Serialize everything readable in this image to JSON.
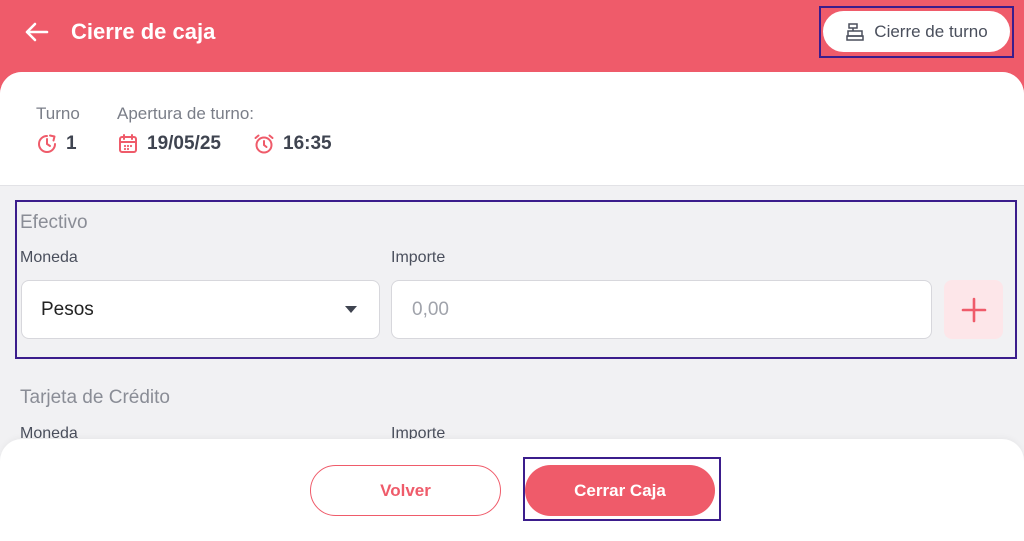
{
  "header": {
    "title": "Cierre de caja",
    "back_icon": "arrow-left-icon",
    "shift_close_label": "Cierre de turno",
    "shift_close_icon": "cash-register-icon"
  },
  "shift_info": {
    "turno_label": "Turno",
    "turno_value": "1",
    "apertura_label": "Apertura de turno:",
    "date": "19/05/25",
    "time": "16:35"
  },
  "efectivo": {
    "title": "Efectivo",
    "currency_label": "Moneda",
    "currency_value": "Pesos",
    "amount_label": "Importe",
    "amount_placeholder": "0,00"
  },
  "tarjeta": {
    "title": "Tarjeta de Crédito",
    "currency_label": "Moneda",
    "amount_label": "Importe"
  },
  "footer": {
    "back_label": "Volver",
    "close_label": "Cerrar Caja"
  },
  "colors": {
    "brand": "#ef5b6a",
    "highlight_outline": "#3b1d8c",
    "background": "#f1f1f3"
  }
}
